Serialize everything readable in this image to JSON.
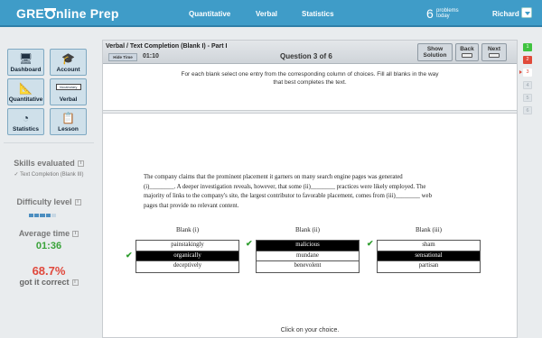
{
  "header": {
    "logo_prefix": "GRE",
    "logo_suffix": "nline Prep",
    "nav": [
      "Quantitative",
      "Verbal",
      "Statistics"
    ],
    "problem_count": "6",
    "problem_label_1": "problems",
    "problem_label_2": "today",
    "user_name": "Richard"
  },
  "sidebar": {
    "tiles": [
      {
        "label": "Dashboard",
        "icon": "computer-icon"
      },
      {
        "label": "Account",
        "icon": "graduation-cap-icon"
      },
      {
        "label": "Quantitative",
        "icon": "compass-icon"
      },
      {
        "label": "Verbal",
        "icon": "vocabulary-icon",
        "icon_text": "Vocabulary"
      },
      {
        "label": "Statistics",
        "icon": "pie-chart-icon"
      },
      {
        "label": "Lesson",
        "icon": "clipboard-icon"
      }
    ],
    "skills_heading": "Skills evaluated",
    "skills_value": "✓ Text Completion (Blank III)",
    "difficulty_heading": "Difficulty level",
    "difficulty_level": 0.8,
    "avg_heading": "Average time",
    "avg_value": "01:36",
    "pct_value": "68.7%",
    "pct_label": "got it correct",
    "info_glyph": "i"
  },
  "question": {
    "title": "Verbal / Text Completion (Blank I) - Part I",
    "hide_time_label": "Hide Time",
    "timer": "01:10",
    "number_label": "Question 3 of 6",
    "show_solution_l1": "Show",
    "show_solution_l2": "Solution",
    "back_label": "Back",
    "next_label": "Next",
    "instructions_l1": "For each blank select one entry from the corresponding column of choices. Fill all blanks in the way",
    "instructions_l2": "that best completes the text.",
    "passage": [
      "The company claims that the prominent placement it garners on many search engine pages was generated",
      "(i)________. A deeper investigation reveals, however, that some (ii)________ practices were likely employed. The",
      "majority of links to the company's site, the largest contributor to favorable placement, comes from (iii)________ web",
      "pages that provide no relevant content."
    ],
    "columns": [
      {
        "heading": "Blank (i)",
        "choices": [
          "painstakingly",
          "organically",
          "deceptively"
        ],
        "selected": 1
      },
      {
        "heading": "Blank (ii)",
        "choices": [
          "malicious",
          "mundane",
          "benevolent"
        ],
        "selected": 0
      },
      {
        "heading": "Blank (iii)",
        "choices": [
          "sham",
          "sensational",
          "partisan"
        ],
        "selected": 1
      }
    ],
    "check_glyph": "✔",
    "click_message": "Click on your choice."
  },
  "rail": [
    {
      "label": "1",
      "state": "green"
    },
    {
      "label": "2",
      "state": "red"
    },
    {
      "label": "3",
      "state": "cur"
    },
    {
      "label": "4",
      "state": "plain"
    },
    {
      "label": "5",
      "state": "plain"
    },
    {
      "label": "6",
      "state": "plain"
    }
  ],
  "colors": {
    "brand": "#3f9cc8",
    "correct": "#2e9d2e",
    "wrong": "#e04a3a"
  }
}
